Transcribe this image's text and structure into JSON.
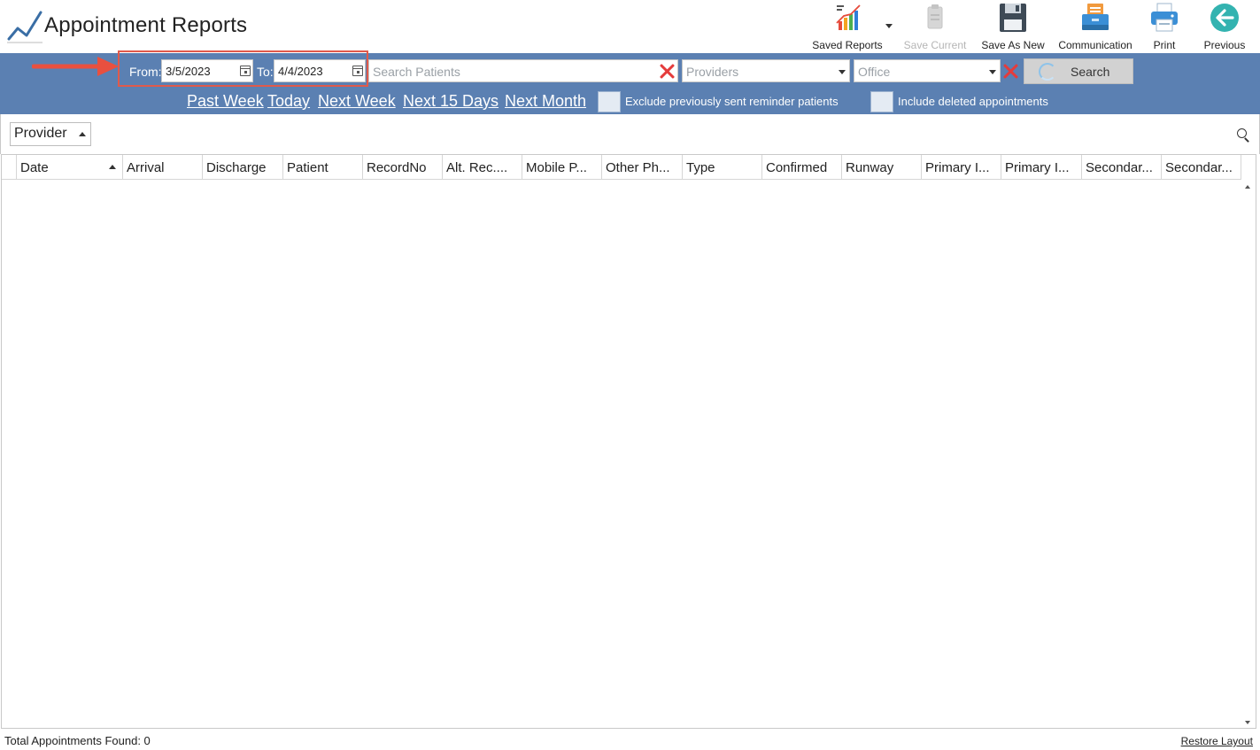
{
  "header": {
    "title": "Appointment Reports",
    "toolbar": [
      {
        "label": "Saved Reports",
        "icon": "bar-chart-icon"
      },
      {
        "label": "Save Current",
        "icon": "clipboard-icon",
        "disabled": true
      },
      {
        "label": "Save As New",
        "icon": "floppy-disk-icon"
      },
      {
        "label": "Communication",
        "icon": "communication-icon"
      },
      {
        "label": "Print",
        "icon": "printer-icon"
      },
      {
        "label": "Previous",
        "icon": "back-arrow-icon"
      }
    ]
  },
  "filters": {
    "from_label": "From:",
    "from_value": "3/5/2023",
    "to_label": "To:",
    "to_value": "4/4/2023",
    "search_placeholder": "Search Patients",
    "providers_placeholder": "Providers",
    "office_placeholder": "Office",
    "search_button": "Search",
    "quick_ranges": [
      "Past Week",
      "Today",
      "Next Week",
      "Next 15 Days",
      "Next Month"
    ],
    "exclude_label": "Exclude previously sent reminder patients",
    "include_label": "Include deleted appointments"
  },
  "group": {
    "chip_label": "Provider"
  },
  "grid": {
    "columns": [
      "Date",
      "Arrival",
      "Discharge",
      "Patient",
      "RecordNo",
      "Alt. Rec....",
      "Mobile P...",
      "Other Ph...",
      "Type",
      "Confirmed",
      "Runway",
      "Primary I...",
      "Primary I...",
      "Secondar...",
      "Secondar..."
    ],
    "rows": []
  },
  "footer": {
    "total": "Total Appointments Found: 0",
    "restore": "Restore Layout"
  },
  "colors": {
    "filter_band": "#5b80b2",
    "highlight_box": "#e05a4b",
    "clear_x": "#e53b3b"
  }
}
